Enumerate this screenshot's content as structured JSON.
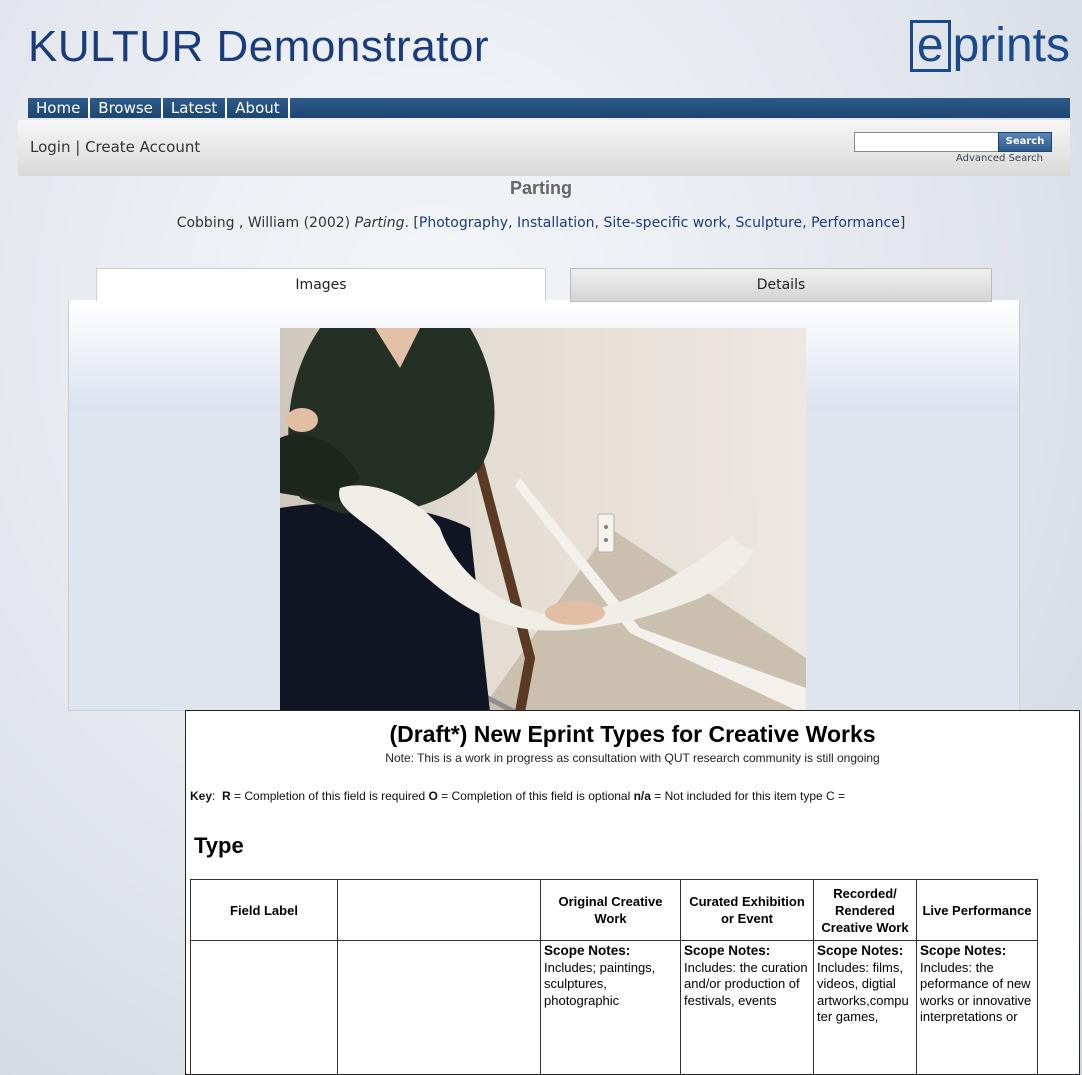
{
  "site": {
    "title": "KULTUR Demonstrator",
    "logo_box": "e",
    "logo_rest": "prints"
  },
  "menu": [
    "Home",
    "Browse",
    "Latest",
    "About"
  ],
  "account": {
    "login": "Login",
    "separator": " | ",
    "create": "Create Account"
  },
  "search": {
    "value": "",
    "button": "Search",
    "advanced": "Advanced Search"
  },
  "record": {
    "title": "Parting",
    "citation": {
      "author": "Cobbing , William (2002) ",
      "work": "Parting",
      "after": ". [",
      "tags": [
        "Photography",
        "Installation",
        "Site-specific work",
        "Sculpture",
        "Performance"
      ],
      "close": "]"
    }
  },
  "tabs": [
    "Images",
    "Details"
  ],
  "document": {
    "title": "(Draft*) New Eprint Types for Creative Works",
    "note": "Note:  This is a work in progress as consultation with QUT research community is still ongoing",
    "key": {
      "label": "Key",
      "r": "R",
      "r_text": " = Completion of this field is required  ",
      "o": "O",
      "o_text": " = Completion of this field is optional  ",
      "na": "n/a",
      "na_text": " = Not included for this item type  C ="
    },
    "heading": "Type",
    "columns": [
      "Field Label",
      "",
      "Original Creative Work",
      "Curated Exhibition or Event",
      "Recorded/ Rendered Creative Work",
      "Live Performance"
    ],
    "scope_label": "Scope Notes:",
    "scope_notes": [
      "Includes; paintings, sculptures, photographic",
      "Includes: the curation and/or production of festivals, events",
      "Includes: films, videos, digtial artworks,compu ter games,",
      "Includes: the peformance of new works or innovative interpretations or"
    ]
  }
}
